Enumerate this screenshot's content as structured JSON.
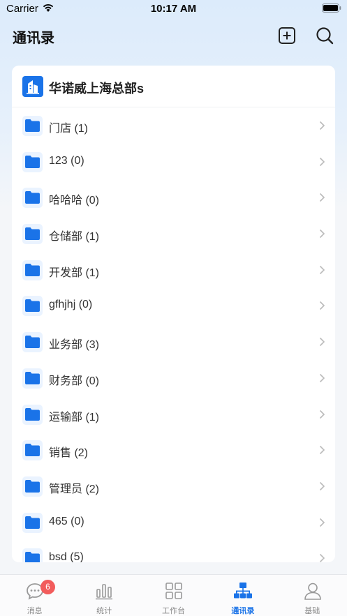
{
  "status": {
    "carrier": "Carrier",
    "time": "10:17 AM"
  },
  "header": {
    "title": "通讯录"
  },
  "org": {
    "name": "华诺威上海总部s"
  },
  "departments": [
    {
      "label": "门店 (1)"
    },
    {
      "label": "123 (0)"
    },
    {
      "label": "哈哈哈 (0)"
    },
    {
      "label": "仓储部 (1)"
    },
    {
      "label": "开发部 (1)"
    },
    {
      "label": "gfhjhj (0)"
    },
    {
      "label": "业务部 (3)"
    },
    {
      "label": "财务部 (0)"
    },
    {
      "label": "运输部 (1)"
    },
    {
      "label": "销售 (2)"
    },
    {
      "label": "管理员 (2)"
    },
    {
      "label": "465 (0)"
    },
    {
      "label": "bsd (5)"
    }
  ],
  "tabs": [
    {
      "label": "消息",
      "icon": "message-icon",
      "badge": "6"
    },
    {
      "label": "统计",
      "icon": "chart-icon"
    },
    {
      "label": "工作台",
      "icon": "grid-icon"
    },
    {
      "label": "通讯录",
      "icon": "org-chart-icon",
      "active": true
    },
    {
      "label": "基础",
      "icon": "person-icon"
    }
  ],
  "colors": {
    "accent": "#1a73e8",
    "folder": "#1a73e8",
    "badge": "#f25c5c"
  }
}
